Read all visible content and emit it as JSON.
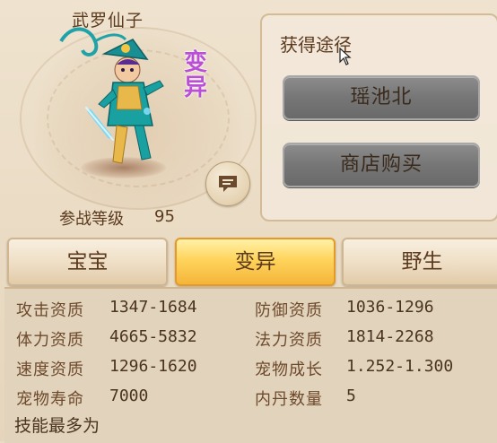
{
  "pet": {
    "name": "武罗仙子",
    "mutation_tag": "变异",
    "battle_level_label": "参战等级",
    "battle_level": "95"
  },
  "acquire": {
    "title": "获得途径",
    "buttons": [
      "瑶池北",
      "商店购买"
    ]
  },
  "tabs": [
    {
      "label": "宝宝",
      "active": false
    },
    {
      "label": "变异",
      "active": true
    },
    {
      "label": "野生",
      "active": false
    }
  ],
  "stats": [
    {
      "label": "攻击资质",
      "value": "1347-1684"
    },
    {
      "label": "防御资质",
      "value": "1036-1296"
    },
    {
      "label": "体力资质",
      "value": "4665-5832"
    },
    {
      "label": "法力资质",
      "value": "1814-2268"
    },
    {
      "label": "速度资质",
      "value": "1296-1620"
    },
    {
      "label": "宠物成长",
      "value": "1.252-1.300"
    },
    {
      "label": "宠物寿命",
      "value": "7000"
    },
    {
      "label": "内丹数量",
      "value": "5"
    }
  ],
  "skills_label": "技能最多为",
  "colors": {
    "active_tab": "#ffd45c",
    "mutation_text": "#b94fd4",
    "gray_button": "#7a7a7a"
  },
  "icons": {
    "chat": "chat-bubble-icon",
    "cursor": "mouse-cursor-icon"
  }
}
